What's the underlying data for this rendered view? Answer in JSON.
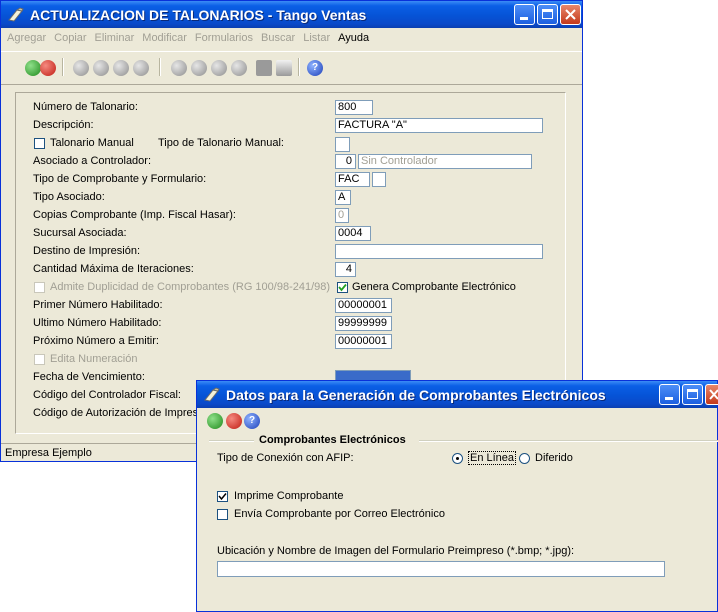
{
  "main": {
    "title": "ACTUALIZACION DE TALONARIOS - Tango Ventas",
    "menu": [
      "Agregar",
      "Copiar",
      "Eliminar",
      "Modificar",
      "Formularios",
      "Buscar",
      "Listar",
      "Ayuda"
    ],
    "labels": {
      "numero": "Número de Talonario:",
      "descripcion": "Descripción:",
      "talonario_manual": "Talonario Manual",
      "tipo_talonario_manual": "Tipo de Talonario Manual:",
      "asociado": "Asociado a Controlador:",
      "tipo_comprobante": "Tipo de Comprobante y Formulario:",
      "tipo_asociado": "Tipo Asociado:",
      "copias": "Copias Comprobante (Imp. Fiscal Hasar):",
      "sucursal": "Sucursal Asociada:",
      "destino": "Destino de Impresión:",
      "cantidad": "Cantidad Máxima de Iteraciones:",
      "admite": "Admite Duplicidad de Comprobantes (RG 100/98-241/98)",
      "genera": "Genera Comprobante Electrónico",
      "primer": "Primer Número Habilitado:",
      "ultimo": "Ultimo Número Habilitado:",
      "proximo": "Próximo Número a Emitir:",
      "edita": "Edita Numeración",
      "fecha": "Fecha de Vencimiento:",
      "codigo_controlador": "Código del Controlador Fiscal:",
      "codigo_autorizacion": "Código de Autorización de Impresión"
    },
    "values": {
      "numero": "800",
      "descripcion": "FACTURA \"A\"",
      "asociado_num": "0",
      "asociado_desc": "Sin Controlador",
      "tipo_comprobante": "FAC",
      "tipo_asociado": "A",
      "copias": "0",
      "sucursal": "0004",
      "cantidad": "4",
      "primer": "00000001",
      "ultimo": "99999999",
      "proximo": "00000001"
    },
    "status": "Empresa Ejemplo"
  },
  "dialog": {
    "title": "Datos para la Generación de Comprobantes Electrónicos",
    "group_title": "Comprobantes Electrónicos",
    "tipo_conexion": "Tipo de Conexión con AFIP:",
    "en_linea": "En Línea",
    "diferido": "Diferido",
    "imprime": "Imprime Comprobante",
    "envia": "Envía Comprobante por Correo Electrónico",
    "ubicacion": "Ubicación y Nombre de Imagen del Formulario Preimpreso (*.bmp; *.jpg):",
    "ubicacion_value": ""
  }
}
